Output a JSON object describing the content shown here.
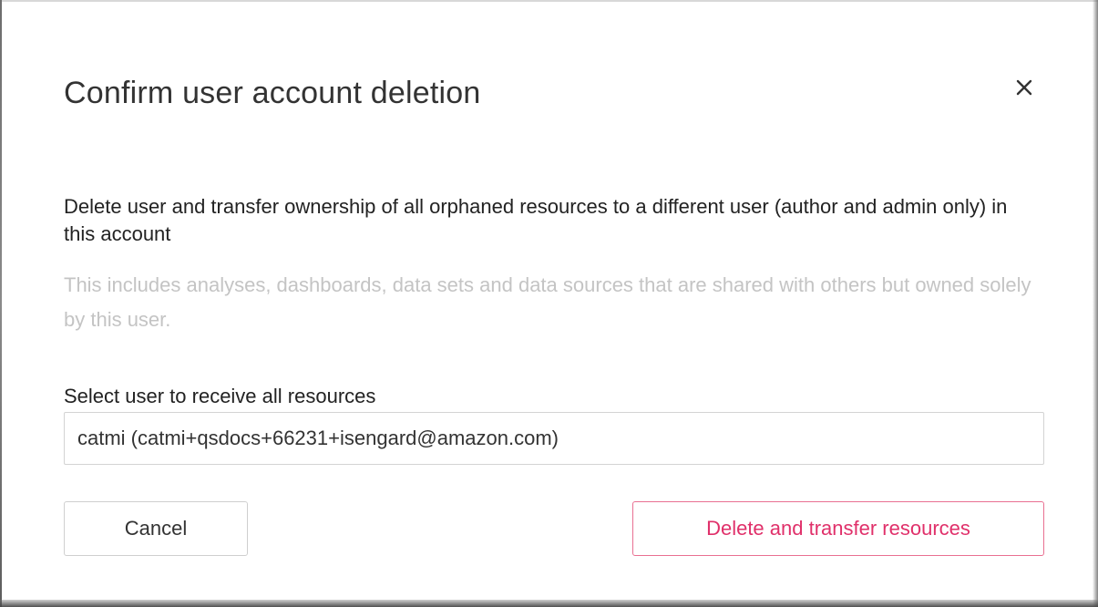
{
  "dialog": {
    "title": "Confirm user account deletion",
    "close_icon": "close-icon",
    "description": "Delete user and transfer ownership of all orphaned resources to a different user (author and admin only) in this account",
    "sub_description": "This includes analyses, dashboards, data sets and data sources that are shared with others but owned solely by this user.",
    "select_label": "Select user to receive all resources",
    "select_value": "catmi (catmi+qsdocs+66231+isengard@amazon.com)",
    "cancel_label": "Cancel",
    "delete_label": "Delete and transfer resources"
  },
  "colors": {
    "title_text": "#333333",
    "body_text": "#222222",
    "muted_text": "#c4c4c4",
    "accent_pink": "#e0306a",
    "accent_border": "#e97092",
    "border_gray": "#d3d3d3"
  }
}
